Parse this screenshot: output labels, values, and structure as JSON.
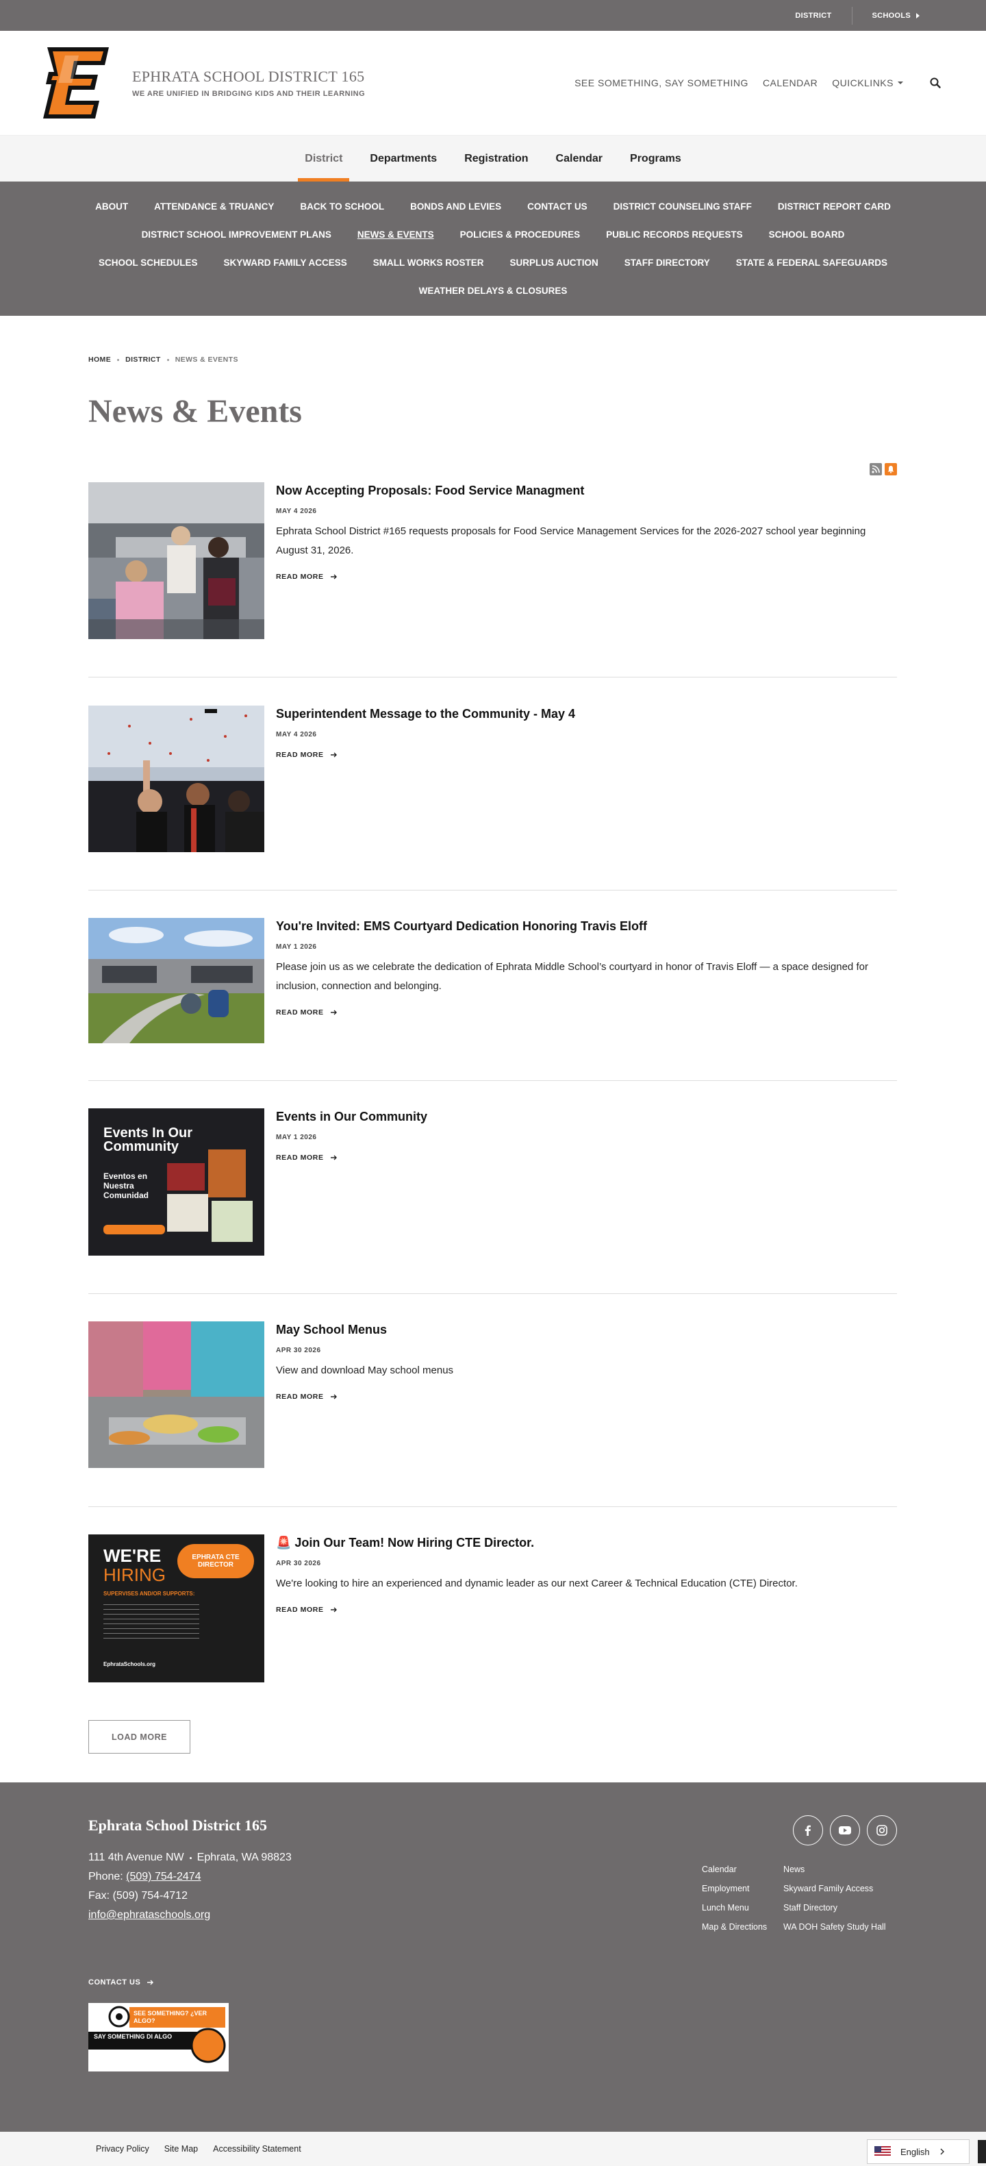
{
  "utility": {
    "district": "DISTRICT",
    "schools": "SCHOOLS"
  },
  "header": {
    "name": "EPHRATA SCHOOL DISTRICT 165",
    "tagline": "WE ARE UNIFIED IN BRIDGING KIDS AND THEIR LEARNING",
    "links": [
      "SEE SOMETHING, SAY SOMETHING",
      "CALENDAR",
      "QUICKLINKS"
    ]
  },
  "main_nav": [
    "District",
    "Departments",
    "Registration",
    "Calendar",
    "Programs"
  ],
  "sub_nav": [
    "ABOUT",
    "ATTENDANCE & TRUANCY",
    "BACK TO SCHOOL",
    "BONDS AND LEVIES",
    "CONTACT US",
    "DISTRICT COUNSELING STAFF",
    "DISTRICT REPORT CARD",
    "DISTRICT SCHOOL IMPROVEMENT PLANS",
    "NEWS & EVENTS",
    "POLICIES & PROCEDURES",
    "PUBLIC RECORDS REQUESTS",
    "SCHOOL BOARD",
    "SCHOOL SCHEDULES",
    "SKYWARD FAMILY ACCESS",
    "SMALL WORKS ROSTER",
    "SURPLUS AUCTION",
    "STAFF DIRECTORY",
    "STATE & FEDERAL SAFEGUARDS",
    "WEATHER DELAYS & CLOSURES"
  ],
  "breadcrumb": [
    "HOME",
    "DISTRICT",
    "NEWS & EVENTS"
  ],
  "page_title": "News & Events",
  "read_more": "READ MORE",
  "load_more": "LOAD MORE",
  "news": [
    {
      "title": "Now Accepting Proposals: Food Service Managment",
      "date": "MAY 4 2026",
      "desc": "Ephrata School District #165 requests proposals for Food Service Management Services for the 2026-2027 school year beginning August 31, 2026."
    },
    {
      "title": "Superintendent Message to the Community - May 4",
      "date": "MAY 4 2026",
      "desc": ""
    },
    {
      "title": "You're Invited: EMS Courtyard Dedication Honoring Travis Eloff",
      "date": "MAY 1 2026",
      "desc": "Please join us as we celebrate the dedication of Ephrata Middle School’s courtyard in honor of Travis Eloff — a space designed for inclusion, connection and belonging."
    },
    {
      "title": "Events in Our Community",
      "date": "MAY 1 2026",
      "desc": ""
    },
    {
      "title": "May School Menus",
      "date": "APR 30 2026",
      "desc": "View and download May school menus"
    },
    {
      "title": "🚨 Join Our Team! Now Hiring CTE Director.",
      "date": "APR 30 2026",
      "desc": "We're looking to hire an experienced and dynamic leader as our next Career & Technical Education (CTE) Director."
    }
  ],
  "thumb_text": {
    "events_en": "Events In Our Community",
    "events_es": "Eventos en Nuestra Comunidad",
    "hiring_1": "WE'RE",
    "hiring_2": "HIRING",
    "hiring_badge": "EPHRATA CTE DIRECTOR",
    "hiring_sub": "SUPERVISES AND/OR SUPPORTS:",
    "hiring_url": "EphrataSchools.org"
  },
  "footer": {
    "name": "Ephrata School District 165",
    "street": "111 4th Avenue NW",
    "city": "Ephrata, WA  98823",
    "phone_label": "Phone: ",
    "phone": "(509) 754-2474",
    "fax": "Fax: (509) 754-4712",
    "email": "info@ephrataschools.org",
    "contact": "CONTACT US",
    "links": [
      "Calendar",
      "News",
      "Employment",
      "Skyward Family Access",
      "Lunch Menu",
      "Staff Directory",
      "Map & Directions",
      "WA DOH Safety Study Hall"
    ],
    "badge_top": "SEE SOMETHING? ¿VER ALGO?",
    "badge_bottom": "SAY SOMETHING DI ALGO"
  },
  "bottom": {
    "links": [
      "Privacy Policy",
      "Site Map",
      "Accessibility Statement"
    ],
    "language": "English"
  },
  "colors": {
    "accent": "#f07f22",
    "gray": "#6e6b6c"
  }
}
